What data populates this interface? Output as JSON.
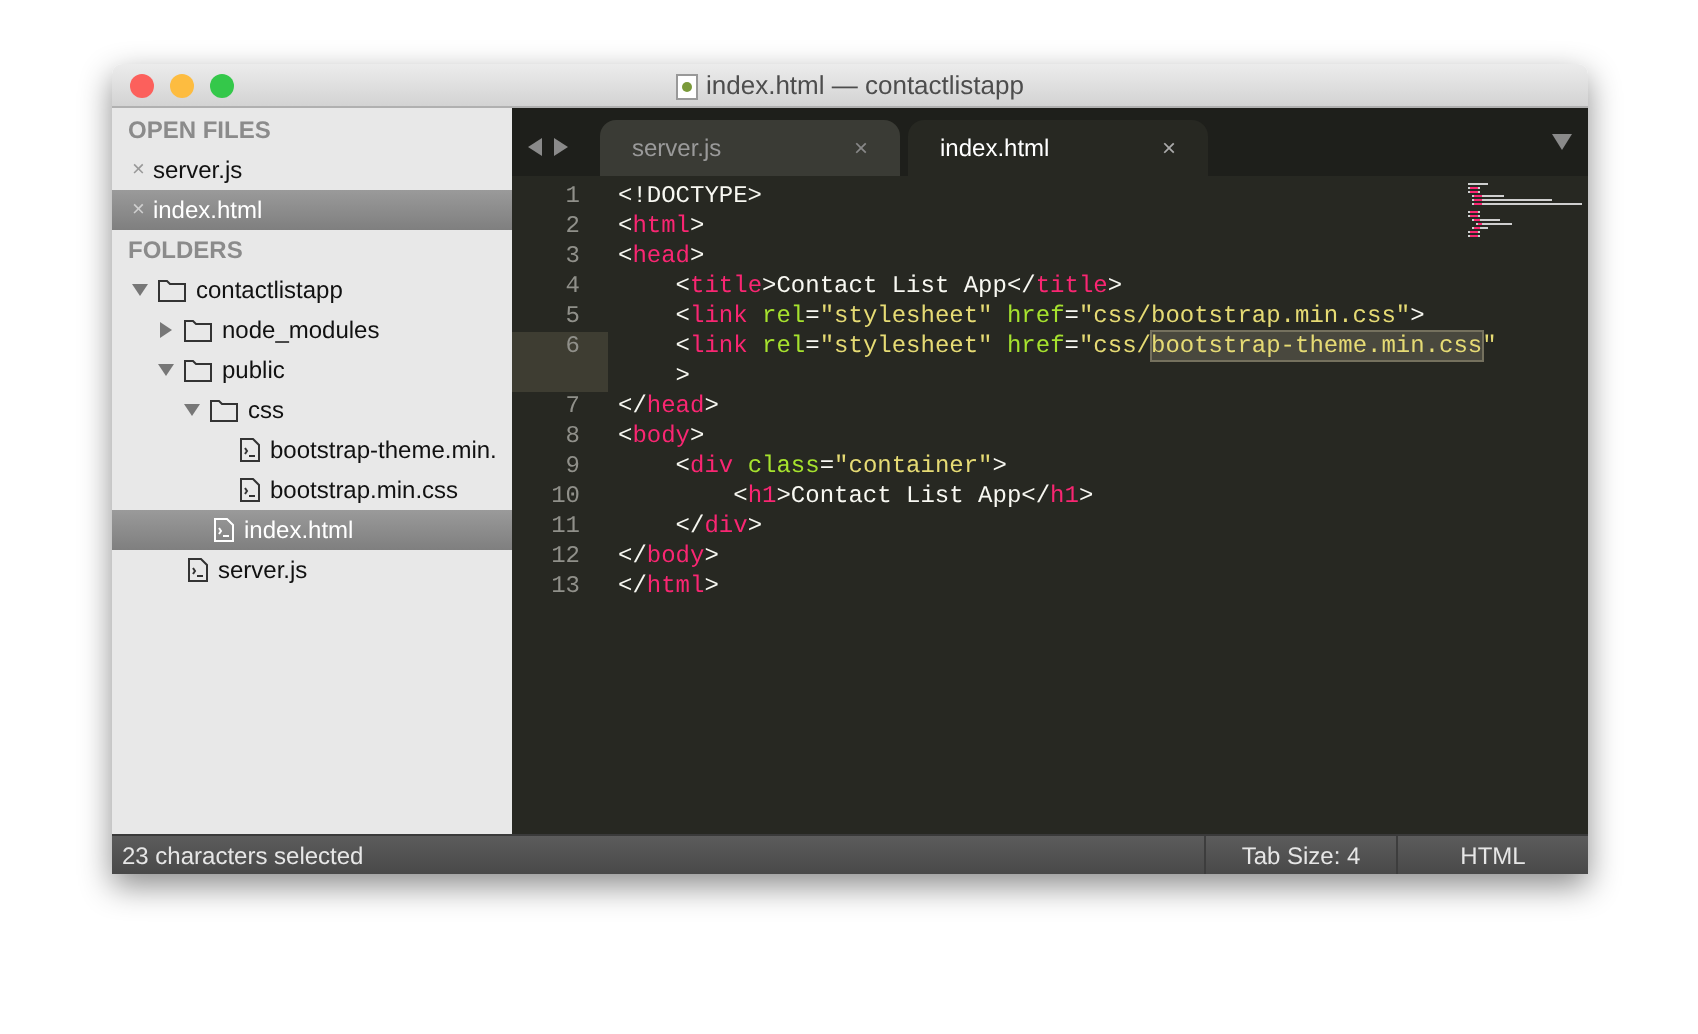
{
  "window": {
    "title": "index.html — contactlistapp"
  },
  "sidebar": {
    "open_files_header": "OPEN FILES",
    "open_files": [
      {
        "close": "×",
        "name": "server.js",
        "selected": false
      },
      {
        "close": "×",
        "name": "index.html",
        "selected": true
      }
    ],
    "folders_header": "FOLDERS",
    "tree": [
      {
        "kind": "folder",
        "name": "contactlistapp",
        "expanded": true,
        "selected": false,
        "children": [
          {
            "kind": "folder",
            "name": "node_modules",
            "expanded": false,
            "selected": false
          },
          {
            "kind": "folder",
            "name": "public",
            "expanded": true,
            "selected": false,
            "children": [
              {
                "kind": "folder",
                "name": "css",
                "expanded": true,
                "selected": false,
                "children": [
                  {
                    "kind": "file",
                    "name": "bootstrap-theme.min.",
                    "selected": false
                  },
                  {
                    "kind": "file",
                    "name": "bootstrap.min.css",
                    "selected": false
                  }
                ]
              },
              {
                "kind": "file",
                "name": "index.html",
                "selected": true
              }
            ]
          },
          {
            "kind": "file",
            "name": "server.js",
            "selected": false
          }
        ]
      }
    ]
  },
  "tabs": [
    {
      "label": "server.js",
      "close": "×",
      "selected": false
    },
    {
      "label": "index.html",
      "close": "×",
      "selected": true
    }
  ],
  "editor": {
    "lines": [
      {
        "number": "1",
        "current": false,
        "tokens": [
          {
            "kind": "punct",
            "text": "<!DOCTYPE>"
          }
        ]
      },
      {
        "number": "2",
        "current": false,
        "tokens": [
          {
            "kind": "punct",
            "text": "<"
          },
          {
            "kind": "tag",
            "text": "html"
          },
          {
            "kind": "punct",
            "text": ">"
          }
        ]
      },
      {
        "number": "3",
        "current": false,
        "tokens": [
          {
            "kind": "punct",
            "text": "<"
          },
          {
            "kind": "tag",
            "text": "head"
          },
          {
            "kind": "punct",
            "text": ">"
          }
        ]
      },
      {
        "number": "4",
        "current": false,
        "tokens": [
          {
            "kind": "punct",
            "text": "    <"
          },
          {
            "kind": "tag",
            "text": "title"
          },
          {
            "kind": "punct",
            "text": ">Contact List App</"
          },
          {
            "kind": "tag",
            "text": "title"
          },
          {
            "kind": "punct",
            "text": ">"
          }
        ]
      },
      {
        "number": "5",
        "current": false,
        "tokens": [
          {
            "kind": "punct",
            "text": "    <"
          },
          {
            "kind": "tag",
            "text": "link"
          },
          {
            "kind": "attr",
            "text": " rel"
          },
          {
            "kind": "punct",
            "text": "="
          },
          {
            "kind": "string",
            "text": "\"stylesheet\""
          },
          {
            "kind": "attr",
            "text": " href"
          },
          {
            "kind": "punct",
            "text": "="
          },
          {
            "kind": "string",
            "text": "\"css/bootstrap.min.css\""
          },
          {
            "kind": "punct",
            "text": ">"
          }
        ]
      },
      {
        "number": "6",
        "current": true,
        "tokens": [
          {
            "kind": "punct",
            "text": "    <"
          },
          {
            "kind": "tag",
            "text": "link"
          },
          {
            "kind": "attr",
            "text": " rel"
          },
          {
            "kind": "punct",
            "text": "="
          },
          {
            "kind": "string",
            "text": "\"stylesheet\""
          },
          {
            "kind": "attr",
            "text": " href"
          },
          {
            "kind": "punct",
            "text": "="
          },
          {
            "kind": "string",
            "text": "\"css/"
          },
          {
            "kind": "string",
            "text": "bootstrap-theme.min.css",
            "selected": true
          },
          {
            "kind": "string",
            "text": "\""
          }
        ],
        "wrap": [
          {
            "kind": "punct",
            "text": "    >"
          }
        ]
      },
      {
        "number": "7",
        "current": false,
        "tokens": [
          {
            "kind": "punct",
            "text": "</"
          },
          {
            "kind": "tag",
            "text": "head"
          },
          {
            "kind": "punct",
            "text": ">"
          }
        ]
      },
      {
        "number": "8",
        "current": false,
        "tokens": [
          {
            "kind": "punct",
            "text": "<"
          },
          {
            "kind": "tag",
            "text": "body"
          },
          {
            "kind": "punct",
            "text": ">"
          }
        ]
      },
      {
        "number": "9",
        "current": false,
        "tokens": [
          {
            "kind": "punct",
            "text": "    <"
          },
          {
            "kind": "tag",
            "text": "div"
          },
          {
            "kind": "attr",
            "text": " class"
          },
          {
            "kind": "punct",
            "text": "="
          },
          {
            "kind": "string",
            "text": "\"container\""
          },
          {
            "kind": "punct",
            "text": ">"
          }
        ]
      },
      {
        "number": "10",
        "current": false,
        "tokens": [
          {
            "kind": "punct",
            "text": "        <"
          },
          {
            "kind": "tag",
            "text": "h1"
          },
          {
            "kind": "punct",
            "text": ">Contact List App</"
          },
          {
            "kind": "tag",
            "text": "h1"
          },
          {
            "kind": "punct",
            "text": ">"
          }
        ]
      },
      {
        "number": "11",
        "current": false,
        "tokens": [
          {
            "kind": "punct",
            "text": "    </"
          },
          {
            "kind": "tag",
            "text": "div"
          },
          {
            "kind": "punct",
            "text": ">"
          }
        ]
      },
      {
        "number": "12",
        "current": false,
        "tokens": [
          {
            "kind": "punct",
            "text": "</"
          },
          {
            "kind": "tag",
            "text": "body"
          },
          {
            "kind": "punct",
            "text": ">"
          }
        ]
      },
      {
        "number": "13",
        "current": false,
        "tokens": [
          {
            "kind": "punct",
            "text": "</"
          },
          {
            "kind": "tag",
            "text": "html"
          },
          {
            "kind": "punct",
            "text": ">"
          }
        ]
      }
    ]
  },
  "status_bar": {
    "selection": "23 characters selected",
    "tab_size": "Tab Size: 4",
    "syntax": "HTML"
  }
}
